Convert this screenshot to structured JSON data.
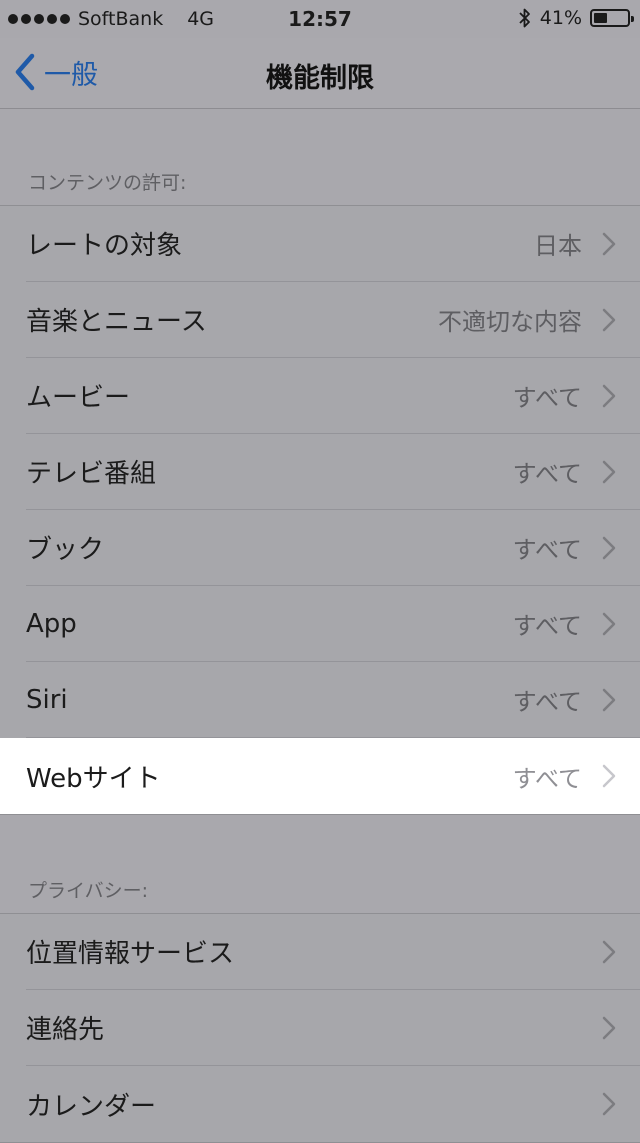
{
  "status": {
    "carrier": "SoftBank",
    "network": "4G",
    "time": "12:57",
    "battery_percent": "41%",
    "battery_level": 0.41
  },
  "nav": {
    "back_label": "一般",
    "title": "機能制限"
  },
  "content_section": {
    "header": "コンテンツの許可:",
    "rows": [
      {
        "label": "レートの対象",
        "value": "日本"
      },
      {
        "label": "音楽とニュース",
        "value": "不適切な内容"
      },
      {
        "label": "ムービー",
        "value": "すべて"
      },
      {
        "label": "テレビ番組",
        "value": "すべて"
      },
      {
        "label": "ブック",
        "value": "すべて"
      },
      {
        "label": "App",
        "value": "すべて"
      },
      {
        "label": "Siri",
        "value": "すべて"
      },
      {
        "label": "Webサイト",
        "value": "すべて"
      }
    ]
  },
  "privacy_section": {
    "header": "プライバシー:",
    "rows": [
      {
        "label": "位置情報サービス"
      },
      {
        "label": "連絡先"
      },
      {
        "label": "カレンダー"
      }
    ]
  },
  "colors": {
    "accent": "#1f5aa8",
    "dim_background": "#a9a8ad",
    "highlight_row": "#ffffff"
  }
}
